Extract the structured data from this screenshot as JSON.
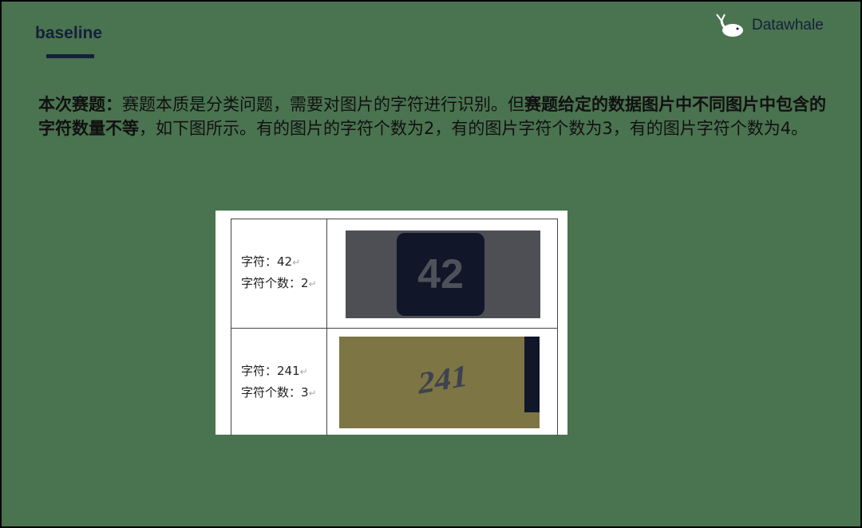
{
  "slide": {
    "title": "baseline",
    "logo_text": "Datawhale",
    "body_bold_1": "本次赛题：",
    "body_normal_1": "赛题本质是分类问题，需要对图片的字符进行识别。但",
    "body_bold_2": "赛题给定的数据图片中不同图片中包含的字符数量不等",
    "body_normal_2": "，如下图所示。有的图片的字符个数为2，有的图片字符个数为3，有的图片字符个数为4。"
  },
  "table": {
    "rows": [
      {
        "chars": "字符：42",
        "count": "字符个数：2",
        "image_text": "42"
      },
      {
        "chars": "字符：241",
        "count": "字符个数：3",
        "image_text": "241"
      }
    ]
  },
  "colors": {
    "background": "#4a7350",
    "title": "#15203a"
  }
}
